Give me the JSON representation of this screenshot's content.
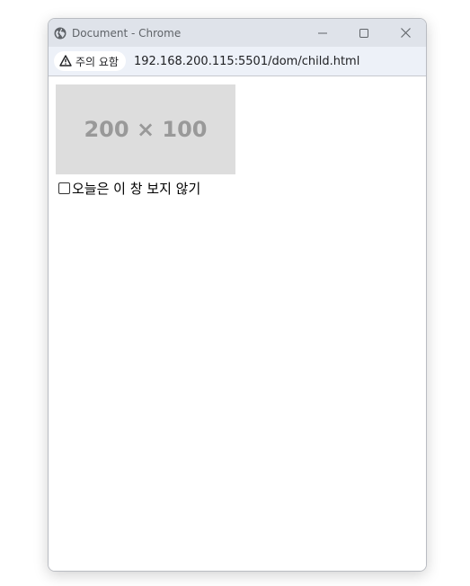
{
  "window": {
    "title": "Document - Chrome",
    "controls": {
      "minimize": "minimize-icon",
      "maximize": "maximize-icon",
      "close": "close-icon"
    }
  },
  "addressbar": {
    "security_label": "주의 요함",
    "security_icon": "warning-triangle-icon",
    "url": "192.168.200.115:5501/dom/child.html"
  },
  "page": {
    "image_placeholder": "200 × 100",
    "checkbox_label": "오늘은 이 창 보지 않기",
    "checkbox_checked": false
  },
  "colors": {
    "titlebar_bg": "#dfe3ea",
    "addressbar_bg": "#edf1f8",
    "placeholder_bg": "#dddddd",
    "placeholder_text": "#999999"
  }
}
